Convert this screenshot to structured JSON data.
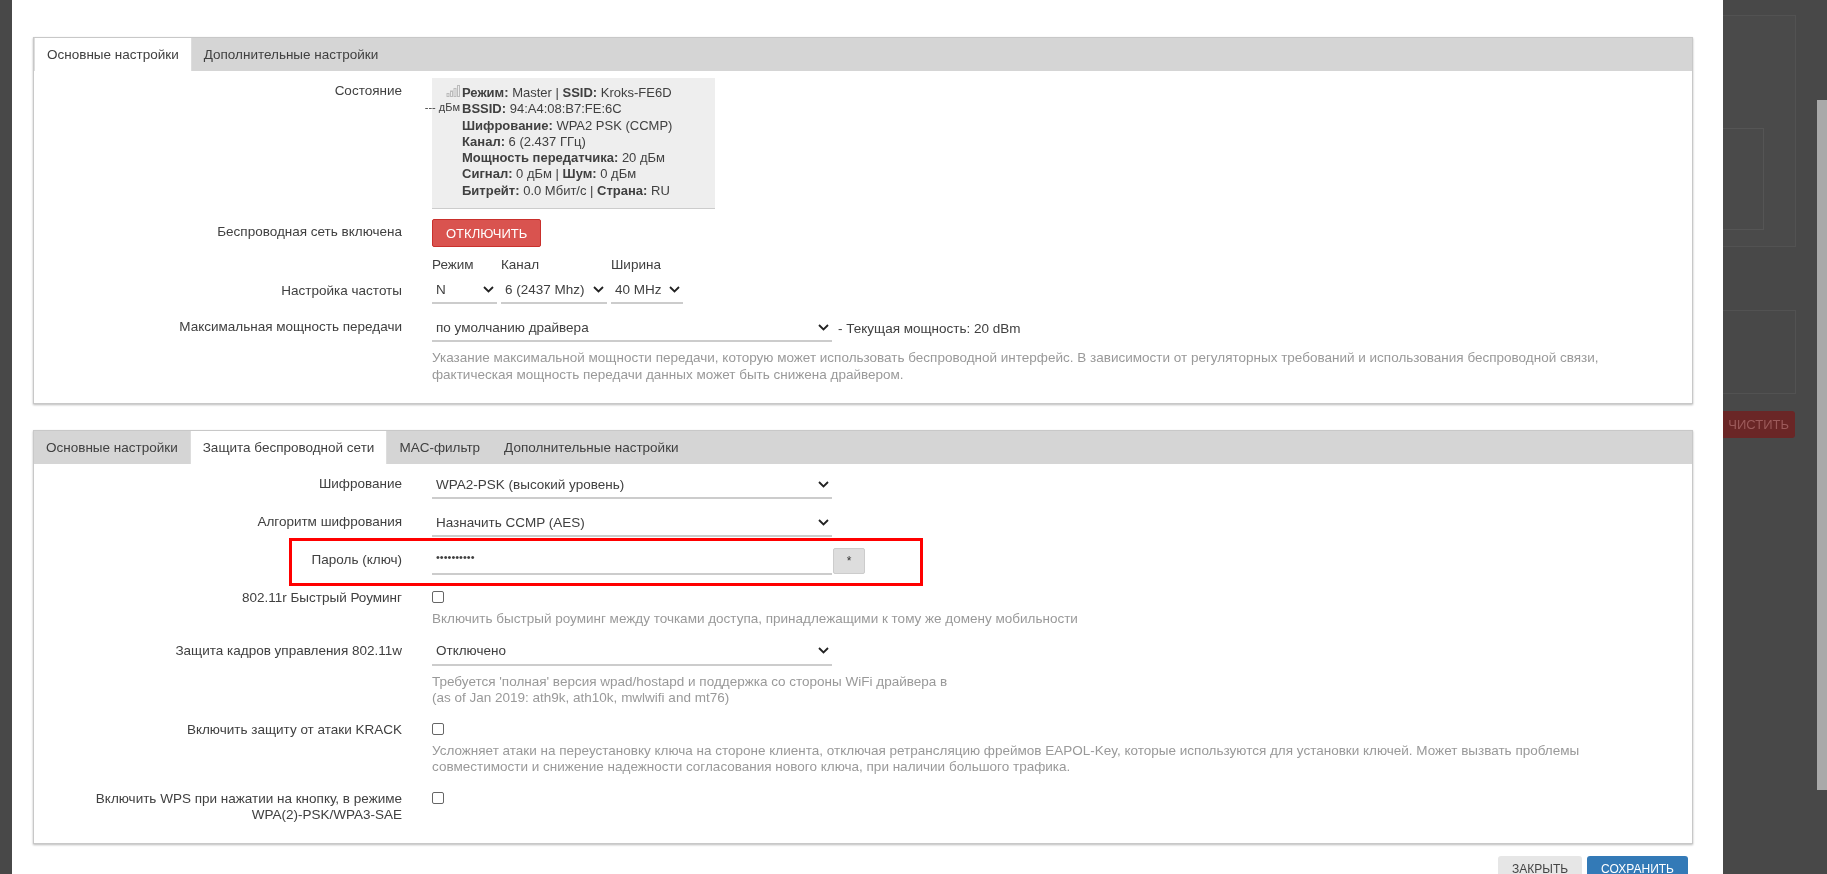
{
  "cards": [
    {
      "tabs": [
        {
          "label": "Основные настройки",
          "selected": true
        },
        {
          "label": "Дополнительные настройки",
          "selected": false
        }
      ],
      "rows": [
        {
          "kind": "status",
          "label": "Состояние",
          "signal": "--- дБм",
          "lines": [
            "**Режим:** Master | **SSID:** Kroks-FE6D",
            "**BSSID:** 94:A4:08:B7:FE:6C",
            "**Шифрование:** WPA2 PSK (CCMP)",
            "**Канал:** 6 (2.437 ГГц)",
            "**Мощность передатчика:** 20 дБм",
            "**Сигнал:** 0 дБм | **Шум:** 0 дБм",
            "**Битрейт:** 0.0 Мбит/с | **Страна:** RU"
          ]
        },
        {
          "kind": "button",
          "label": "Беспроводная сеть включена",
          "button": "ОТКЛЮЧИТЬ"
        },
        {
          "kind": "frequency",
          "label": "Настройка частоты",
          "fields": [
            {
              "label": "Режим",
              "value": "N"
            },
            {
              "label": "Канал",
              "value": "6 (2437 Mhz)"
            },
            {
              "label": "Ширина",
              "value": "40 MHz"
            }
          ]
        },
        {
          "kind": "select",
          "label": "Максимальная мощность передачи",
          "value": "по умолчанию драйвера",
          "suffix": "- Текущая мощность: 20 dBm",
          "description": [
            "Указание максимальной мощности передачи, которую может использовать беспроводной интерфейс. В зависимости от регуляторных требований и использования беспроводной связи, фактическая мощность передачи данных может быть снижена драйвером."
          ]
        }
      ]
    },
    {
      "tabs": [
        {
          "label": "Основные настройки",
          "selected": false
        },
        {
          "label": "Защита беспроводной сети",
          "selected": true
        },
        {
          "label": "MAC-фильтр",
          "selected": false
        },
        {
          "label": "Дополнительные настройки",
          "selected": false
        }
      ],
      "rows": [
        {
          "kind": "select",
          "label": "Шифрование",
          "value": "WPA2-PSK (высокий уровень)"
        },
        {
          "kind": "select",
          "label": "Алгоритм шифрования",
          "value": "Назначить CCMP (AES)"
        },
        {
          "kind": "password",
          "label": "Пароль (ключ)",
          "value": "••••••••••",
          "button": "*",
          "highlighted": true
        },
        {
          "kind": "checkbox",
          "label": "802.11r Быстрый Роуминг",
          "checked": false,
          "description": [
            "Включить быстрый роуминг между точками доступа, принадлежащими к тому же домену мобильности"
          ]
        },
        {
          "kind": "select",
          "label": "Защита кадров управления 802.11w",
          "value": "Отключено",
          "description": [
            "Требуется 'полная' версия wpad/hostapd и поддержка со стороны WiFi драйвера в",
            "(as of Jan 2019: ath9k, ath10k, mwlwifi and mt76)"
          ]
        },
        {
          "kind": "checkbox",
          "label": "Включить защиту от атаки KRACK",
          "checked": false,
          "description": [
            "Усложняет атаки на переустановку ключа на стороне клиента, отключая ретрансляцию фреймов EAPOL-Key, которые используются для установки ключей. Может вызвать проблемы совместимости и снижение надежности согласования нового ключа, при наличии большого трафика."
          ]
        },
        {
          "kind": "checkbox",
          "label": "Включить WPS при нажатии на кнопку, в режиме WPA(2)-PSK/WPA3-SAE",
          "checked": false
        }
      ]
    }
  ],
  "footer": {
    "buttons": [
      "ЗАКРЫТЬ",
      "СОХРАНИТЬ"
    ]
  },
  "background": {
    "button": "ЧИСТИТЬ"
  }
}
